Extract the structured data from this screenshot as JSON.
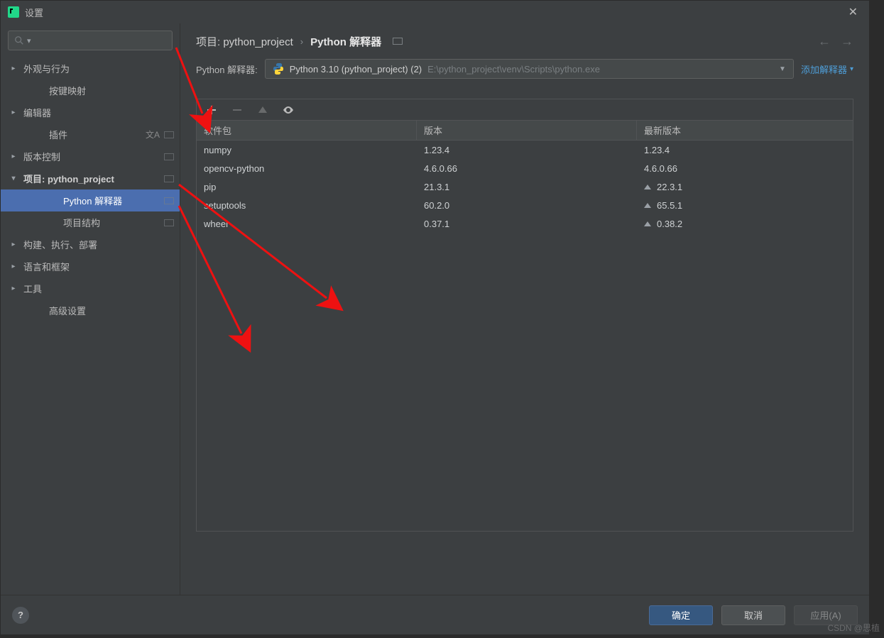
{
  "window": {
    "title": "设置"
  },
  "search": {
    "placeholder": ""
  },
  "sidebar": {
    "items": [
      {
        "label": "外观与行为",
        "type": "group"
      },
      {
        "label": "按键映射",
        "type": "leaf"
      },
      {
        "label": "编辑器",
        "type": "group"
      },
      {
        "label": "插件",
        "type": "leaf",
        "extra_icons": true
      },
      {
        "label": "版本控制",
        "type": "group",
        "proj_scope": true
      },
      {
        "label": "项目: python_project",
        "type": "group",
        "expanded": true,
        "bold": true,
        "proj_scope": true
      },
      {
        "label": "Python 解释器",
        "type": "child",
        "selected": true,
        "proj_scope": true
      },
      {
        "label": "项目结构",
        "type": "child",
        "proj_scope": true
      },
      {
        "label": "构建、执行、部署",
        "type": "group"
      },
      {
        "label": "语言和框架",
        "type": "group"
      },
      {
        "label": "工具",
        "type": "group"
      },
      {
        "label": "高级设置",
        "type": "leaf"
      }
    ]
  },
  "breadcrumb": {
    "part1": "项目: python_project",
    "sep": "›",
    "part2": "Python 解释器"
  },
  "interpreter": {
    "label": "Python 解释器:",
    "name": "Python 3.10 (python_project) (2)",
    "path": "E:\\python_project\\venv\\Scripts\\python.exe",
    "add_link": "添加解释器"
  },
  "packages": {
    "columns": {
      "name": "软件包",
      "version": "版本",
      "latest": "最新版本"
    },
    "rows": [
      {
        "name": "numpy",
        "version": "1.23.4",
        "latest": "1.23.4",
        "up": false
      },
      {
        "name": "opencv-python",
        "version": "4.6.0.66",
        "latest": "4.6.0.66",
        "up": false
      },
      {
        "name": "pip",
        "version": "21.3.1",
        "latest": "22.3.1",
        "up": true
      },
      {
        "name": "setuptools",
        "version": "60.2.0",
        "latest": "65.5.1",
        "up": true
      },
      {
        "name": "wheel",
        "version": "0.37.1",
        "latest": "0.38.2",
        "up": true
      }
    ]
  },
  "footer": {
    "ok": "确定",
    "cancel": "取消",
    "apply": "应用(A)"
  },
  "watermark": "CSDN @思植"
}
